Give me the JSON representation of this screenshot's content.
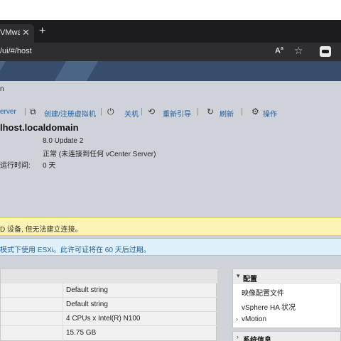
{
  "browser": {
    "tab_title": "VMware",
    "tab_close": "✕",
    "new_tab": "+",
    "url": "/ui/#/host",
    "read_aloud": "Aᴬ"
  },
  "breadcrumb": "n",
  "toolbar": {
    "server_fragment": "erver",
    "create_vm": "创建/注册虚拟机",
    "shutdown": "关机",
    "reboot": "重新引导",
    "refresh": "刷新",
    "actions": "操作"
  },
  "host": {
    "name": "lhost.localdomain",
    "rows": [
      {
        "label": "",
        "value": "8.0 Update 2"
      },
      {
        "label": "",
        "value": "正常 (未连接到任何 vCenter Server)"
      },
      {
        "label": "运行时间:",
        "value": "0 天"
      }
    ]
  },
  "alerts": {
    "warning": "D 设备, 但无法建立连接。",
    "info": "模式下使用 ESXi。此许可证将在 60 天后过期。"
  },
  "hardware": {
    "values": [
      "Default string",
      "Default string",
      "4 CPUs x Intel(R) N100",
      "15.75 GB"
    ]
  },
  "config_panel": {
    "title": "配置",
    "items": [
      "映像配置文件",
      "vSphere HA 状况",
      "vMotion"
    ]
  },
  "system_panel": {
    "title": "系统信息"
  },
  "colors": {
    "banner": "#364d6b",
    "link": "#1f5e9e",
    "warning_bg": "#fcf3b5",
    "info_bg": "#e0f0fa"
  }
}
